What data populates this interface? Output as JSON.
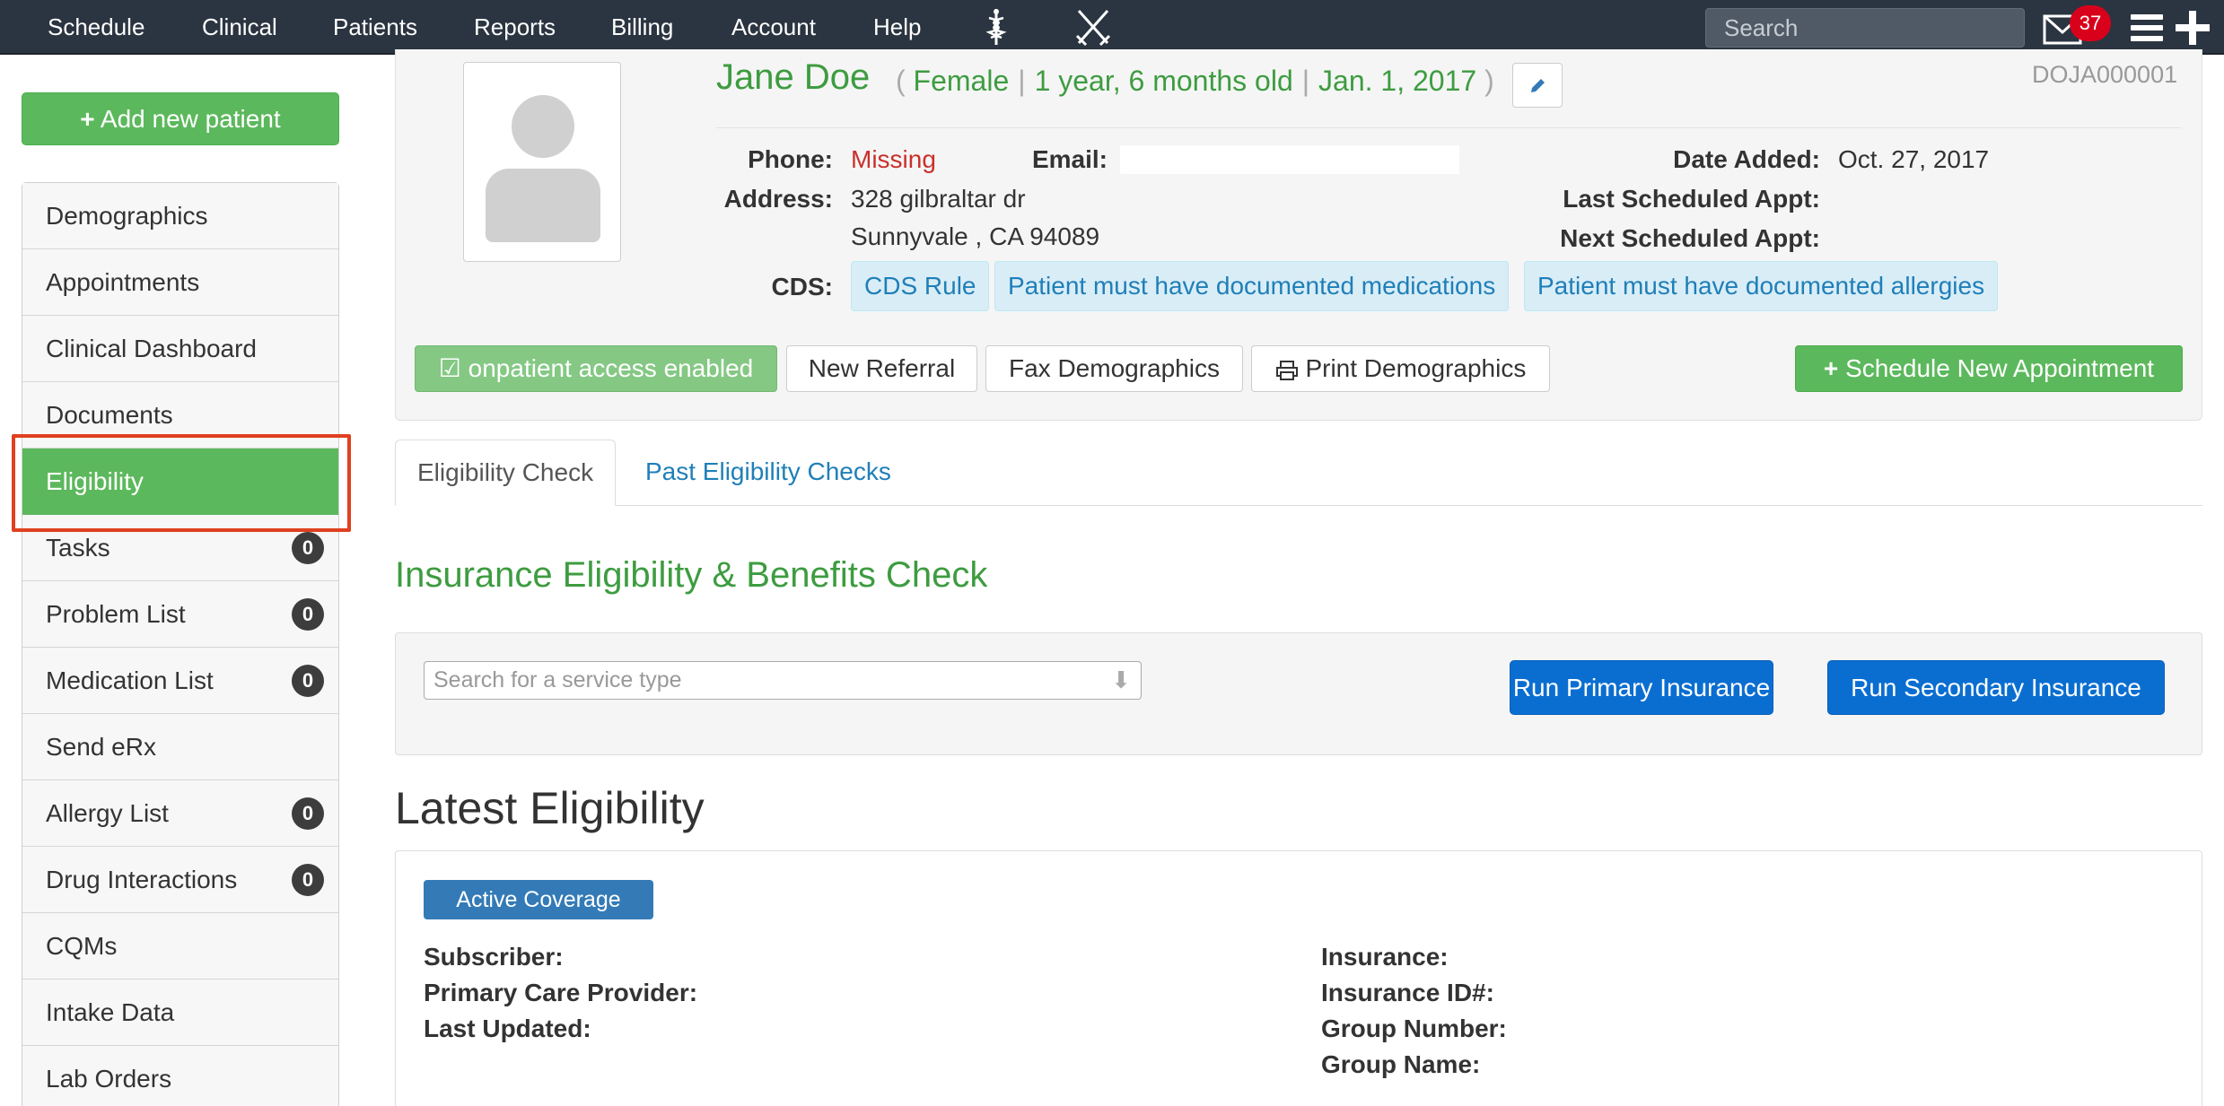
{
  "nav": {
    "items": [
      "Schedule",
      "Clinical",
      "Patients",
      "Reports",
      "Billing",
      "Account",
      "Help"
    ],
    "search_placeholder": "Search",
    "mail_count": "37"
  },
  "sidebar": {
    "add_button": "Add new patient",
    "items": [
      {
        "label": "Demographics",
        "count": null
      },
      {
        "label": "Appointments",
        "count": null
      },
      {
        "label": "Clinical Dashboard",
        "count": null
      },
      {
        "label": "Documents",
        "count": null
      },
      {
        "label": "Eligibility",
        "count": null,
        "active": true
      },
      {
        "label": "Tasks",
        "count": "0"
      },
      {
        "label": "Problem List",
        "count": "0"
      },
      {
        "label": "Medication List",
        "count": "0"
      },
      {
        "label": "Send eRx",
        "count": null
      },
      {
        "label": "Allergy List",
        "count": "0"
      },
      {
        "label": "Drug Interactions",
        "count": "0"
      },
      {
        "label": "CQMs",
        "count": null
      },
      {
        "label": "Intake Data",
        "count": null
      },
      {
        "label": "Lab Orders",
        "count": null
      }
    ]
  },
  "patient": {
    "name": "Jane Doe",
    "open_paren": "(",
    "sex": "Female",
    "age": "1 year, 6 months old",
    "dob": "Jan. 1, 2017",
    "close_paren": ")",
    "id": "DOJA000001",
    "phone_label": "Phone:",
    "phone_value": "Missing",
    "email_label": "Email:",
    "address_label": "Address:",
    "address_line1": "328 gilbraltar dr",
    "address_line2": "Sunnyvale , CA 94089",
    "date_added_label": "Date Added:",
    "date_added_value": "Oct. 27, 2017",
    "last_appt_label": "Last Scheduled Appt:",
    "next_appt_label": "Next Scheduled Appt:",
    "cds_label": "CDS:",
    "cds_tags": [
      "CDS Rule",
      "Patient must have documented medications",
      "Patient must have documented allergies"
    ]
  },
  "actions": {
    "onpatient": "onpatient access enabled",
    "new_referral": "New Referral",
    "fax_demographics": "Fax Demographics",
    "print_demographics": "Print Demographics",
    "schedule_new": "Schedule New Appointment"
  },
  "tabs": [
    "Eligibility Check",
    "Past Eligibility Checks"
  ],
  "check": {
    "title": "Insurance Eligibility & Benefits Check",
    "service_placeholder": "Search for a service type",
    "run_primary": "Run Primary Insurance",
    "run_secondary": "Run Secondary Insurance"
  },
  "latest": {
    "title": "Latest Eligibility",
    "status": "Active Coverage",
    "subscriber_label": "Subscriber:",
    "pcp_label": "Primary Care Provider:",
    "last_updated_label": "Last Updated:",
    "insurance_label": "Insurance:",
    "insurance_id_label": "Insurance ID#:",
    "group_number_label": "Group Number:",
    "group_name_label": "Group Name:"
  },
  "colors": {
    "nav_bg": "#2b3541",
    "accent_green": "#5cb85c",
    "title_green": "#3d9c40",
    "primary_blue": "#0a6ed1",
    "highlight_red": "#e0401f"
  }
}
